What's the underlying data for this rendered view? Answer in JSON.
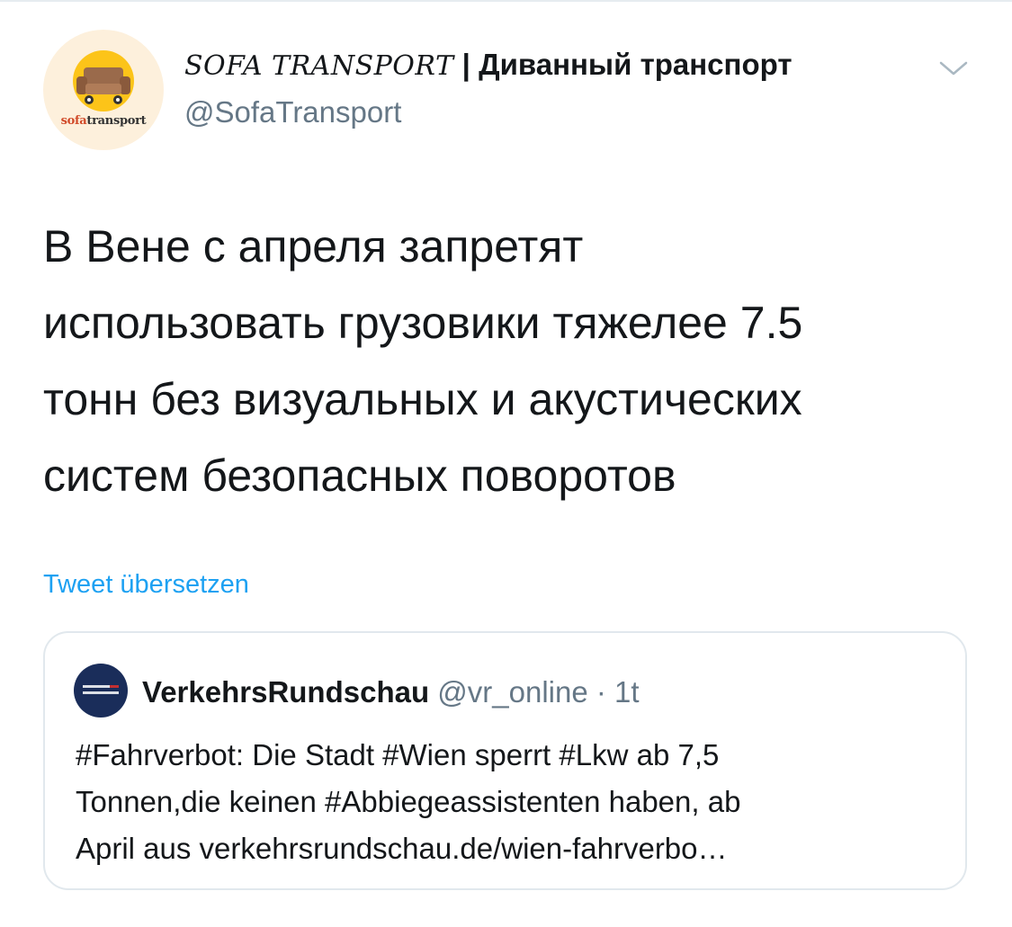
{
  "tweet": {
    "author": {
      "display_name_serif": "SOFA TRANSPORT",
      "display_name_separator": " | ",
      "display_name_bold": "Диванный транспорт",
      "handle": "@SofaTransport",
      "avatar_label_part1": "sofa",
      "avatar_label_part2": "transport"
    },
    "text": "В Вене с апреля запретят\nиспользовать грузовики тяжелее 7.5\nтонн без визуальных и акустических\nсистем безопасных поворотов",
    "translate_label": "Tweet übersetzen"
  },
  "quoted_tweet": {
    "author_name": "VerkehrsRundschau",
    "handle": "@vr_online",
    "separator": " · ",
    "time": "1t",
    "text": "#Fahrverbot: Die Stadt #Wien sperrt #Lkw ab 7,5\nTonnen,die keinen #Abbiegeassistenten haben, ab\nApril aus verkehrsrundschau.de/wien-fahrverbo…"
  },
  "icons": {
    "avatar": "sofa-icon",
    "menu": "chevron-down-icon"
  },
  "colors": {
    "link": "#1da1f2",
    "secondary_text": "#657786",
    "primary_text": "#14171a",
    "card_border": "#e1e8ed",
    "avatar_accent": "#fcc419",
    "brand_red": "#d14b2a"
  }
}
